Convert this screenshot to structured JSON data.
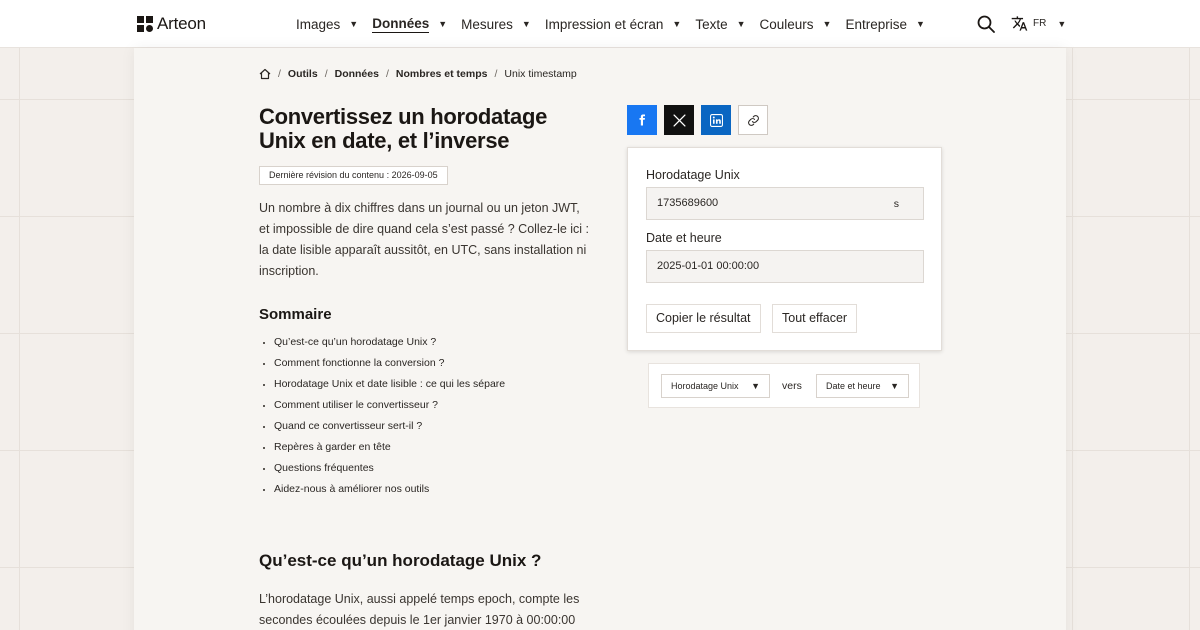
{
  "brand": {
    "name": "Arteon"
  },
  "nav": {
    "items": [
      {
        "label": "Images",
        "active": false
      },
      {
        "label": "Données",
        "active": true
      },
      {
        "label": "Mesures",
        "active": false
      },
      {
        "label": "Impression et écran",
        "active": false
      },
      {
        "label": "Texte",
        "active": false
      },
      {
        "label": "Couleurs",
        "active": false
      },
      {
        "label": "Entreprise",
        "active": false
      }
    ],
    "language": "FR"
  },
  "breadcrumb": {
    "items": [
      "Outils",
      "Données",
      "Nombres et temps",
      "Unix timestamp"
    ]
  },
  "page": {
    "title": "Convertissez un horodatage Unix en date, et l’inverse",
    "revision": "Dernière révision du contenu : 2026-09-05",
    "intro": "Un nombre à dix chiffres dans un journal ou un jeton JWT, et impossible de dire quand cela s’est passé ? Collez-le ici : la date lisible apparaît aussitôt, en UTC, sans installation ni inscription."
  },
  "toc": {
    "title": "Sommaire",
    "items": [
      "Qu’est-ce qu’un horodatage Unix ?",
      "Comment fonctionne la conversion ?",
      "Horodatage Unix et date lisible : ce qui les sépare",
      "Comment utiliser le convertisseur ?",
      "Quand ce convertisseur sert-il ?",
      "Repères à garder en tête",
      "Questions fréquentes",
      "Aidez-nous à améliorer nos outils"
    ]
  },
  "section": {
    "title": "Qu’est-ce qu’un horodatage Unix ?",
    "body": "L’horodatage Unix, aussi appelé temps epoch, compte les secondes écoulées depuis le 1er janvier 1970 à 00:00:00"
  },
  "converter": {
    "input_label": "Horodatage Unix",
    "input_value": "1735689600",
    "input_unit": "s",
    "output_label": "Date et heure",
    "output_value": "2025-01-01 00:00:00",
    "copy_button": "Copier le résultat",
    "clear_button": "Tout effacer"
  },
  "direction": {
    "from": "Horodatage Unix",
    "connector": "vers",
    "to": "Date et heure"
  },
  "colors": {
    "facebook": "#1877f2",
    "x": "#111111",
    "linkedin": "#0a66c2"
  }
}
